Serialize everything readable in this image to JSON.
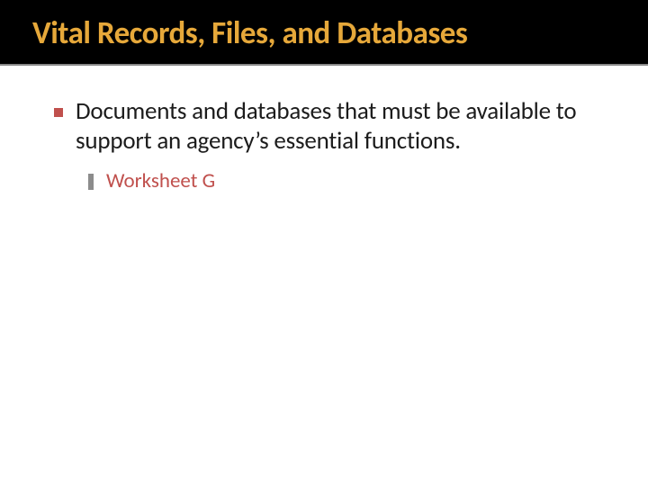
{
  "title": "Vital Records, Files, and Databases",
  "bullets": [
    {
      "text": "Documents and databases that must be available to support an agency’s essential functions.",
      "sub": [
        {
          "text": "Worksheet G"
        }
      ]
    }
  ]
}
